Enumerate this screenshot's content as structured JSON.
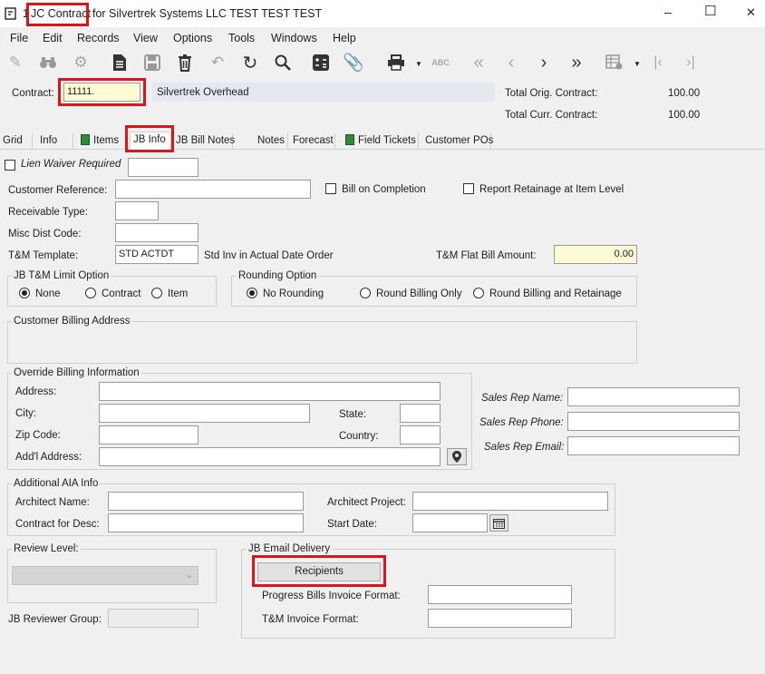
{
  "window": {
    "title_prefix": "1",
    "title_module": "JC Contract",
    "title_rest": "for Silvertrek Systems LLC TEST TEST TEST",
    "minimize_glyph": "–",
    "maximize_glyph": "☐",
    "close_glyph": "✕"
  },
  "menu": [
    "File",
    "Edit",
    "Records",
    "View",
    "Options",
    "Tools",
    "Windows",
    "Help"
  ],
  "toolbar_icons": [
    "edit-icon",
    "binoculars-icon",
    "settings-gear-icon",
    "document-icon",
    "save-icon",
    "delete-icon",
    "undo-icon",
    "refresh-icon",
    "search-icon",
    "calculator-icon",
    "attachment-icon",
    "print-icon",
    "spellcheck-icon",
    "first-record-icon",
    "previous-record-icon",
    "next-record-icon",
    "last-record-icon",
    "grid-settings-icon",
    "first-page-icon",
    "last-page-icon"
  ],
  "header": {
    "contract_label": "Contract:",
    "contract_value": "11111.",
    "contract_desc": "Silvertrek Overhead",
    "total_orig_label": "Total Orig. Contract:",
    "total_orig_value": "100.00",
    "total_curr_label": "Total Curr. Contract:",
    "total_curr_value": "100.00"
  },
  "tabs": [
    "Grid",
    "Info",
    "Items",
    "JB Info",
    "JB Bill Notes",
    "Notes",
    "Forecast",
    "Field Tickets",
    "Customer POs"
  ],
  "form": {
    "lien_waiver_label": "Lien Waiver Required",
    "customer_reference_label": "Customer Reference:",
    "bill_on_completion_label": "Bill on Completion",
    "report_retainage_label": "Report Retainage at Item Level",
    "receivable_type_label": "Receivable Type:",
    "misc_dist_code_label": "Misc Dist Code:",
    "tm_template_label": "T&M Template:",
    "tm_template_value": "STD ACTDT",
    "tm_template_desc": "Std Inv in Actual Date Order",
    "tm_flat_bill_label": "T&M Flat Bill Amount:",
    "tm_flat_bill_value": "0.00",
    "jb_limit_group": "JB T&M Limit Option",
    "limit_none": "None",
    "limit_contract": "Contract",
    "limit_item": "Item",
    "rounding_group": "Rounding Option",
    "rounding_none": "No Rounding",
    "rounding_billing_only": "Round Billing Only",
    "rounding_billing_retainage": "Round Billing and Retainage",
    "customer_billing_address": "Customer Billing Address",
    "override_group": "Override Billing Information",
    "address_label": "Address:",
    "city_label": "City:",
    "state_label": "State:",
    "zip_label": "Zip Code:",
    "country_label": "Country:",
    "addl_address_label": "Add'l Address:",
    "sales_rep_name_label": "Sales Rep Name:",
    "sales_rep_phone_label": "Sales Rep Phone:",
    "sales_rep_email_label": "Sales Rep Email:",
    "aia_group": "Additional AIA Info",
    "architect_name_label": "Architect Name:",
    "architect_project_label": "Architect Project:",
    "contract_for_desc_label": "Contract for Desc:",
    "start_date_label": "Start Date:",
    "review_level_group": "Review Level:",
    "jb_reviewer_group_label": "JB Reviewer Group:",
    "email_delivery_group": "JB Email Delivery",
    "recipients_button": "Recipients",
    "progress_bills_format_label": "Progress Bills Invoice Format:",
    "tm_invoice_format_label": "T&M Invoice Format:"
  },
  "colors": {
    "highlight": "#d8171d",
    "yellow_field": "#fdfbd6",
    "window_bg": "#f0f0f0"
  }
}
